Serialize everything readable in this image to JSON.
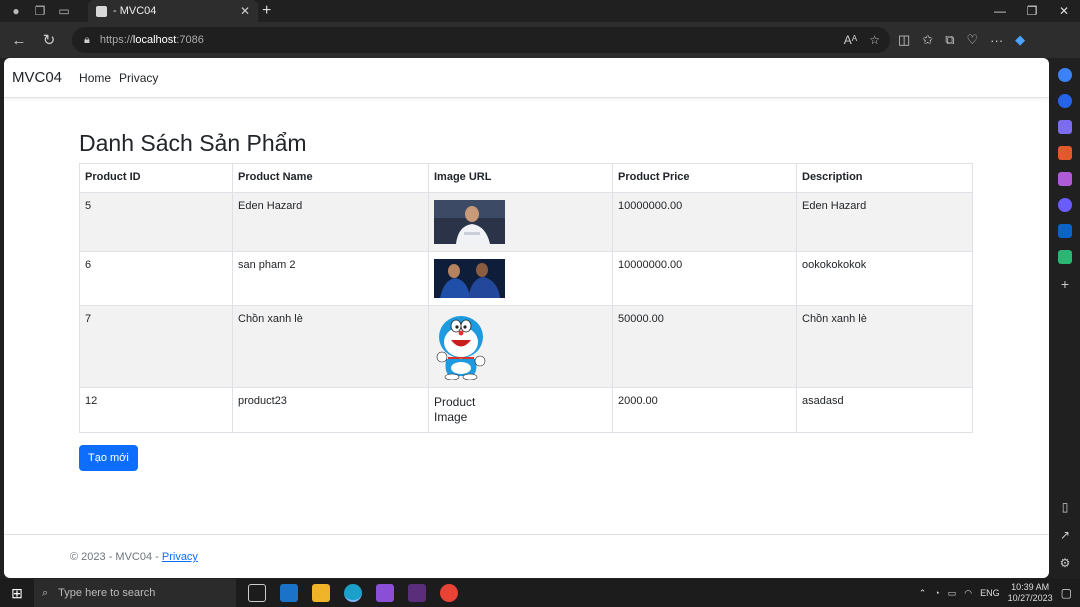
{
  "browser": {
    "tab_title": "- MVC04",
    "url_scheme": "https://",
    "url_host": "localhost",
    "url_port": ":7086"
  },
  "site": {
    "brand": "MVC04",
    "nav": [
      "Home",
      "Privacy"
    ]
  },
  "main": {
    "heading": "Danh Sách Sản Phẩm",
    "columns": [
      "Product ID",
      "Product Name",
      "Image URL",
      "Product Price",
      "Description"
    ],
    "rows": [
      {
        "id": "5",
        "name": "Eden Hazard",
        "image": "photo-hazard",
        "price": "10000000.00",
        "description": "Eden Hazard"
      },
      {
        "id": "6",
        "name": "san pham 2",
        "image": "photo-players",
        "price": "10000000.00",
        "description": "ookokokokok"
      },
      {
        "id": "7",
        "name": "Chồn xanh lè",
        "image": "doraemon",
        "price": "50000.00",
        "description": "Chồn xanh lè"
      },
      {
        "id": "12",
        "name": "product23",
        "image_alt": "Product Image",
        "price": "2000.00",
        "description": "asadasd"
      }
    ],
    "create_button": "Tạo mới"
  },
  "footer": {
    "text": "© 2023 - MVC04 - ",
    "link": "Privacy"
  },
  "taskbar": {
    "search_placeholder": "Type here to search",
    "language": "ENG",
    "time": "10:39 AM",
    "date": "10/27/2023"
  }
}
